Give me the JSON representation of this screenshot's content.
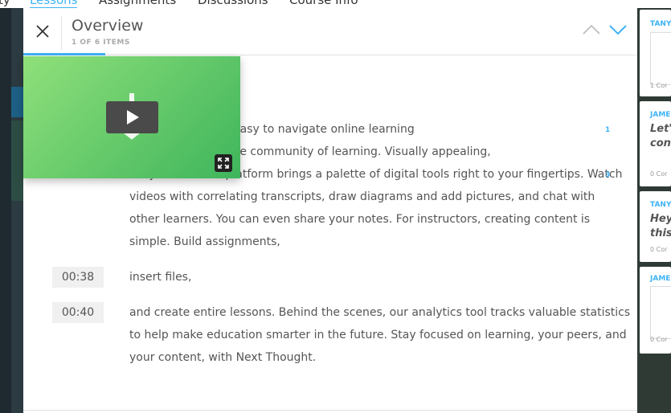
{
  "top_nav": {
    "items": [
      "ty",
      "Lessons",
      "Assignments",
      "Discussions",
      "Course Info"
    ],
    "active_index": 1
  },
  "modal": {
    "title": "Overview",
    "subtitle": "1 OF 6 ITEMS"
  },
  "transcript": {
    "block1": [
      "es a one of a kind easy to navigate online learning",
      "create an interactive community of learning. Visually appealing,",
      "easy to use. Our platform brings a palette of digital tools right to your fingertips. Watch",
      "videos with correlating transcripts, draw diagrams and add pictures, and chat with",
      "other learners. You can even share your notes. For instructors, creating content is",
      "simple. Build assignments,"
    ],
    "line2": {
      "time": "00:38",
      "text": "insert files,"
    },
    "line3": {
      "time": "00:40",
      "lines": [
        "and create entire lessons. Behind the scenes, our analytics tool tracks valuable statistics",
        "to help make education smarter in the future. Stay focused on learning, your peers, and",
        "your content, with Next Thought."
      ]
    },
    "note_counts": [
      "1",
      "3"
    ]
  },
  "notes": [
    {
      "author": "TANY",
      "text": "",
      "count": "1 Cor"
    },
    {
      "author": "JAMES",
      "text": "Let's conc",
      "count": "0 Cor"
    },
    {
      "author": "TANY",
      "text": "Hey this",
      "count": "0 Cor"
    },
    {
      "author": "JAMES",
      "text": "",
      "count": "0 Cor"
    }
  ],
  "colors": {
    "accent": "#3fb3f6",
    "video_green": "#5cc96a"
  },
  "icons": {
    "close": "close-icon",
    "up": "chevron-up-icon",
    "down": "chevron-down-icon",
    "play": "play-icon",
    "fullscreen": "fullscreen-icon"
  }
}
